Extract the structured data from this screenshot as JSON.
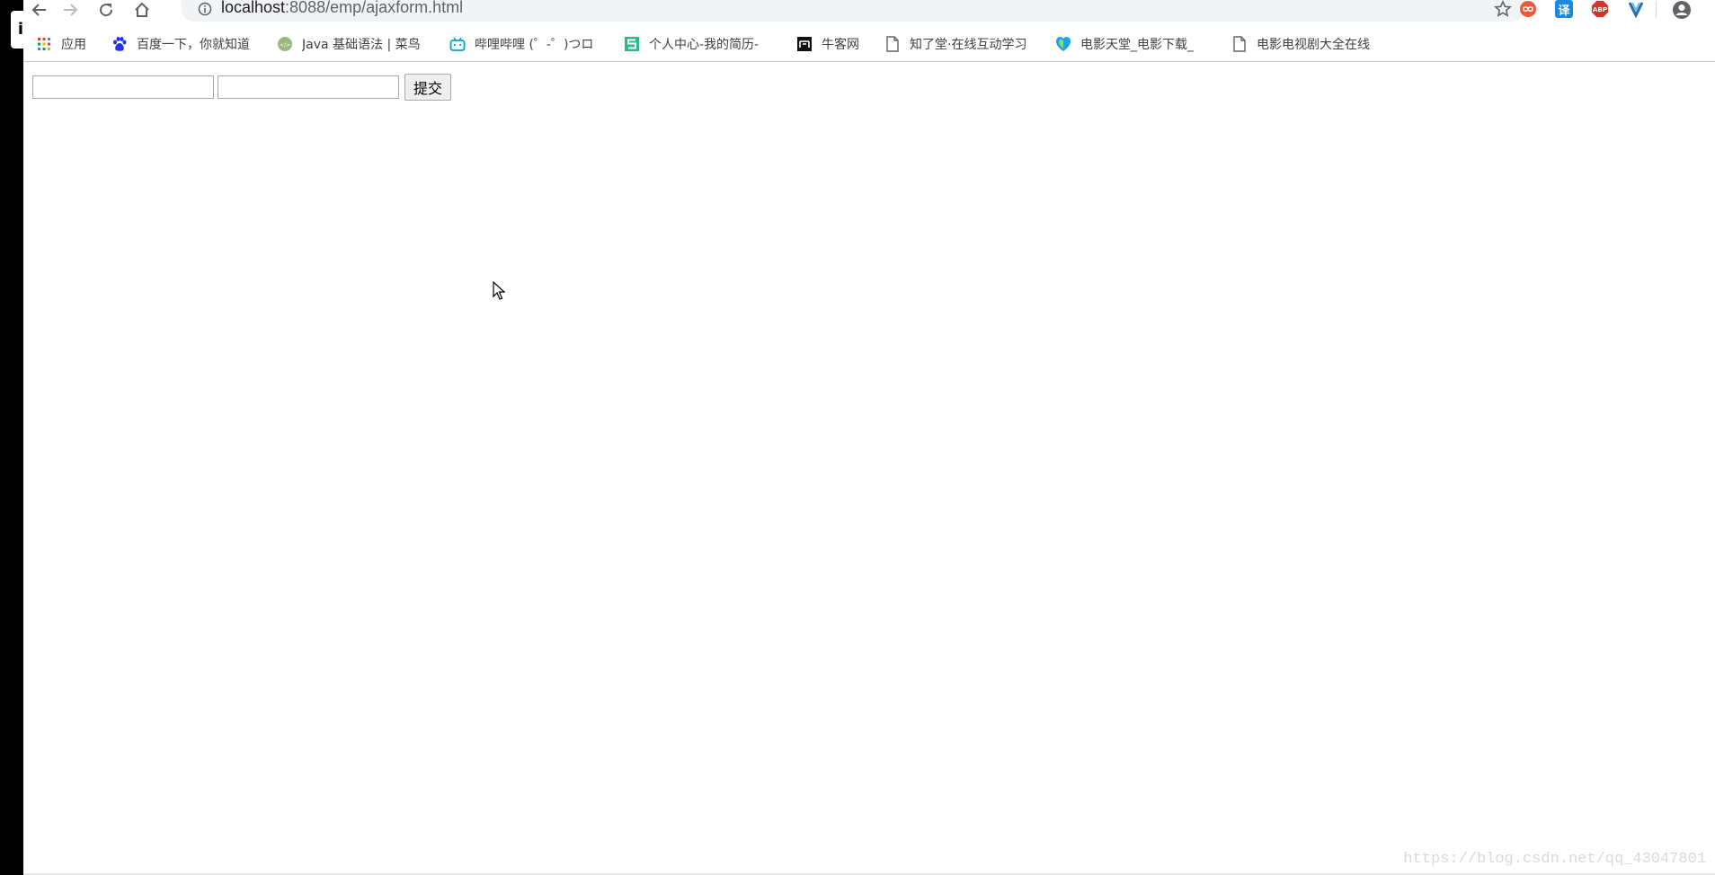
{
  "window": {
    "corner_glyph": "i"
  },
  "toolbar": {
    "url_host": "localhost",
    "url_rest": ":8088/emp/ajaxform.html",
    "icons": [
      "back-icon",
      "forward-icon",
      "reload-icon",
      "home-icon",
      "info-icon",
      "star-icon"
    ],
    "extensions": [
      {
        "name": "infinity-extension-icon",
        "label": ""
      },
      {
        "name": "translate-extension-icon",
        "label": "译"
      },
      {
        "name": "adblock-plus-icon",
        "label": "ABP"
      },
      {
        "name": "v-extension-icon",
        "label": ""
      }
    ]
  },
  "bookmarks": [
    {
      "label": "应用",
      "icon": "apps-grid-icon"
    },
    {
      "label": "百度一下，你就知道",
      "icon": "baidu-paw-icon"
    },
    {
      "label": "Java 基础语法 | 菜鸟",
      "icon": "runoob-icon"
    },
    {
      "label": "哔哩哔哩 (゜-゜)つロ",
      "icon": "bilibili-icon"
    },
    {
      "label": "个人中心-我的简历-",
      "icon": "s-logo-icon"
    },
    {
      "label": "牛客网",
      "icon": "nowcoder-icon"
    },
    {
      "label": "知了堂·在线互动学习",
      "icon": "page-icon"
    },
    {
      "label": "电影天堂_电影下载_",
      "icon": "heart-shield-icon"
    },
    {
      "label": "电影电视剧大全在线",
      "icon": "page-icon"
    }
  ],
  "form": {
    "input1_value": "",
    "input2_value": "",
    "submit_label": "提交"
  },
  "watermark": "https://blog.csdn.net/qq_43047801",
  "colors": {
    "omnibox_bg": "#f1f3f4",
    "translate_blue": "#1a88e5",
    "abp_red": "#d9322d",
    "infinity_red": "#ec5a3a",
    "bilibili_blue": "#00a1d6",
    "s_logo_green": "#2cb88c"
  }
}
